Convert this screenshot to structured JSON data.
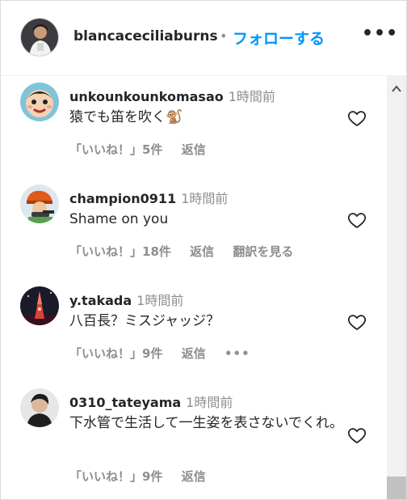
{
  "header": {
    "username": "blancaceciliaburns",
    "separator": "•",
    "follow_label": "フォローする",
    "more_label": "•••"
  },
  "comments": [
    {
      "username": "unkounkounkomasao",
      "time": "1時間前",
      "text": "猿でも笛を吹く🐒",
      "likes": "「いいね！」5件",
      "reply": "返信"
    },
    {
      "username": "champion0911",
      "time": "1時間前",
      "text": "Shame on you",
      "likes": "「いいね！」18件",
      "reply": "返信",
      "translate": "翻訳を見る"
    },
    {
      "username": "y.takada",
      "time": "1時間前",
      "text": "八百長？ミスジャッジ？",
      "likes": "「いいね！」9件",
      "reply": "返信",
      "more": "•••"
    },
    {
      "username": "0310_tateyama",
      "time": "1時間前",
      "text": "下水管で生活して一生姿を表さないでくれ。",
      "likes": "「いいね！」9件",
      "reply": "返信"
    }
  ]
}
